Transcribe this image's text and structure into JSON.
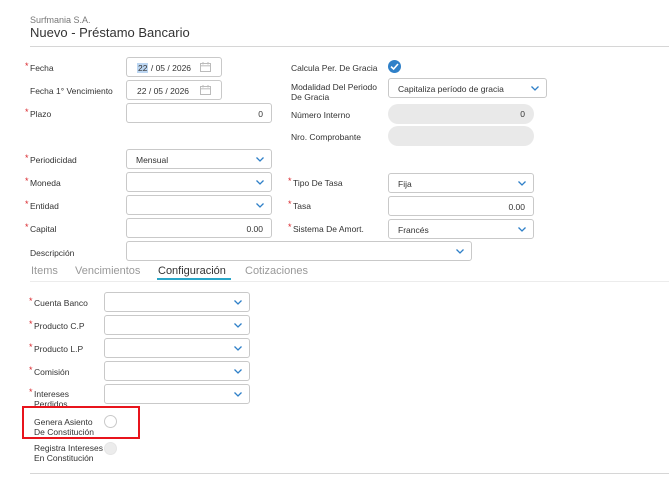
{
  "header": {
    "company": "Surfmania S.A.",
    "title": "Nuevo - Préstamo Bancario"
  },
  "form": {
    "fecha": {
      "label": "Fecha",
      "day": "22",
      "month": "05",
      "year": "2026"
    },
    "fecha_venc": {
      "label": "Fecha 1° Vencimiento",
      "day": "22",
      "month": "05",
      "year": "2026"
    },
    "plazo": {
      "label": "Plazo",
      "value": "0"
    },
    "calcula_gracia": {
      "label": "Calcula Per. De Gracia",
      "checked": true
    },
    "modalidad": {
      "label_line1": "Modalidad Del Periodo",
      "label_line2": "De Gracia",
      "value": "Capitaliza período de gracia"
    },
    "numero_interno": {
      "label": "Número Interno",
      "value": "0"
    },
    "nro_comprobante": {
      "label": "Nro. Comprobante",
      "value": ""
    },
    "periodicidad": {
      "label": "Periodicidad",
      "value": "Mensual"
    },
    "moneda": {
      "label": "Moneda",
      "value": ""
    },
    "tipo_tasa": {
      "label": "Tipo De Tasa",
      "value": "Fija"
    },
    "entidad": {
      "label": "Entidad",
      "value": ""
    },
    "tasa": {
      "label": "Tasa",
      "value": "0.00"
    },
    "capital": {
      "label": "Capital",
      "value": "0.00"
    },
    "sistema_amort": {
      "label": "Sistema De Amort.",
      "value": "Francés"
    },
    "descripcion": {
      "label": "Descripción",
      "value": ""
    }
  },
  "tabs": [
    {
      "label": "Items",
      "active": false
    },
    {
      "label": "Vencimientos",
      "active": false
    },
    {
      "label": "Configuración",
      "active": true
    },
    {
      "label": "Cotizaciones",
      "active": false
    }
  ],
  "config": {
    "cuenta_banco": {
      "label": "Cuenta Banco",
      "value": ""
    },
    "producto_cp": {
      "label": "Producto C.P",
      "value": ""
    },
    "producto_lp": {
      "label": "Producto L.P",
      "value": ""
    },
    "comision": {
      "label": "Comisión",
      "value": ""
    },
    "intereses_perdidos": {
      "label_line1": "Intereses",
      "label_line2": "Perdidos",
      "value": ""
    },
    "genera_asiento": {
      "label_line1": "Genera Asiento",
      "label_line2": "De Constitución",
      "selected": false
    },
    "registra_intereses": {
      "label_line1": "Registra Intereses",
      "label_line2": "En Constitución",
      "selected": false,
      "disabled": true
    }
  },
  "colors": {
    "accent": "#2f80c8",
    "tab_underline": "#29a6c8",
    "required": "#d9262c",
    "highlight_box": "#e8141c"
  }
}
